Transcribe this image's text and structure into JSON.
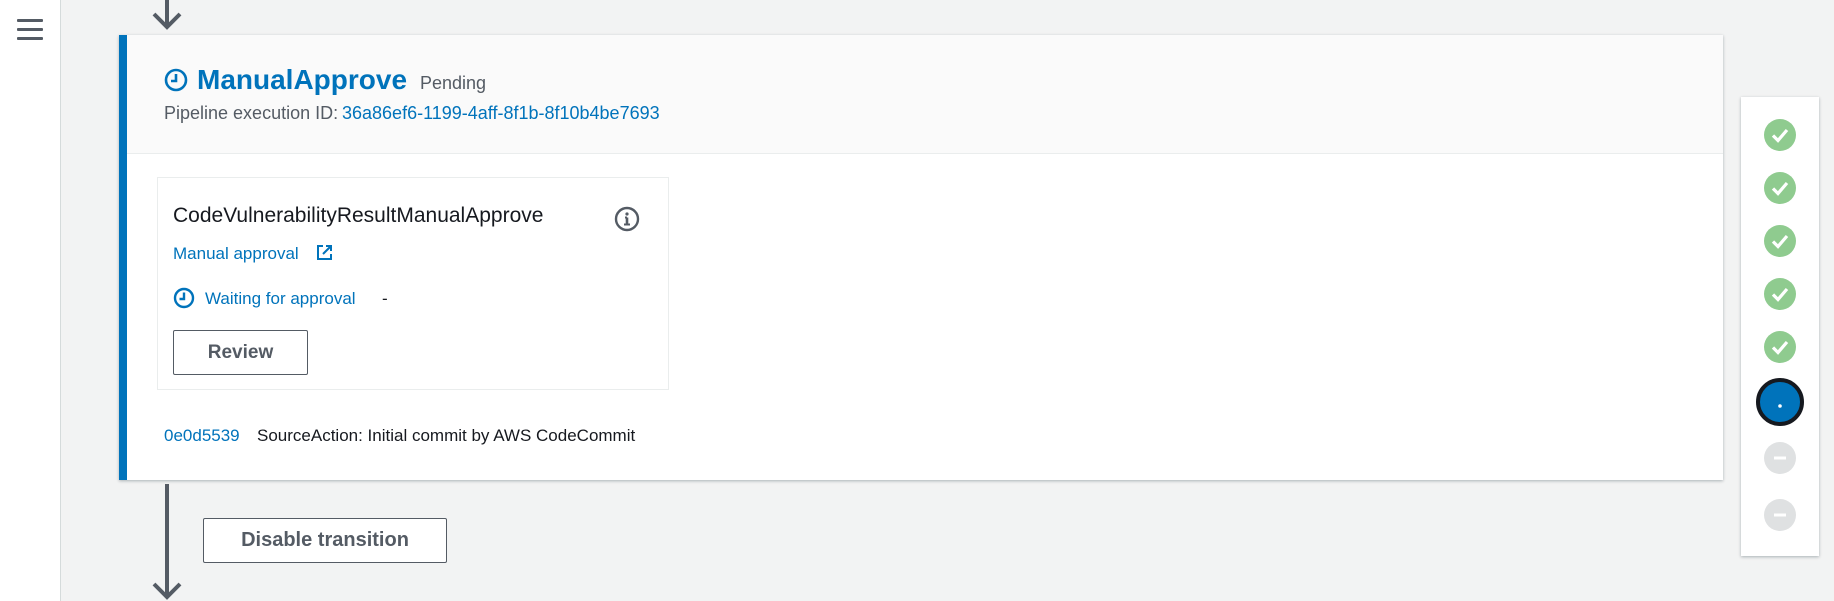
{
  "nav": {
    "menu_icon": "hamburger-icon"
  },
  "stage": {
    "title": "ManualApprove",
    "status": "Pending",
    "status_icon": "clock-icon",
    "exec_label": "Pipeline execution ID:",
    "exec_id": "36a86ef6-1199-4aff-8f1b-8f10b4be7693",
    "accent_color": "#0073bb"
  },
  "action": {
    "name": "CodeVulnerabilityResultManualApprove",
    "info_icon": "info-icon",
    "provider_label": "Manual approval",
    "provider_icon": "external-link-icon",
    "status_label": "Waiting for approval",
    "status_detail": "-",
    "review_button": "Review"
  },
  "source": {
    "commit_id": "0e0d5539",
    "message": "SourceAction: Initial commit by AWS CodeCommit"
  },
  "transition": {
    "disable_button": "Disable transition"
  },
  "stage_navigator": {
    "items": [
      {
        "state": "succeeded",
        "icon": "check-icon",
        "color": "#8fcb8f"
      },
      {
        "state": "succeeded",
        "icon": "check-icon",
        "color": "#8fcb8f"
      },
      {
        "state": "succeeded",
        "icon": "check-icon",
        "color": "#8fcb8f"
      },
      {
        "state": "succeeded",
        "icon": "check-icon",
        "color": "#8fcb8f"
      },
      {
        "state": "succeeded",
        "icon": "check-icon",
        "color": "#8fcb8f"
      },
      {
        "state": "in-progress",
        "icon": "current-dot-icon",
        "color": "#0073bb"
      },
      {
        "state": "inactive",
        "icon": "minus-icon",
        "color": "#dfe1e2"
      },
      {
        "state": "inactive",
        "icon": "minus-icon",
        "color": "#dfe1e2"
      }
    ]
  }
}
